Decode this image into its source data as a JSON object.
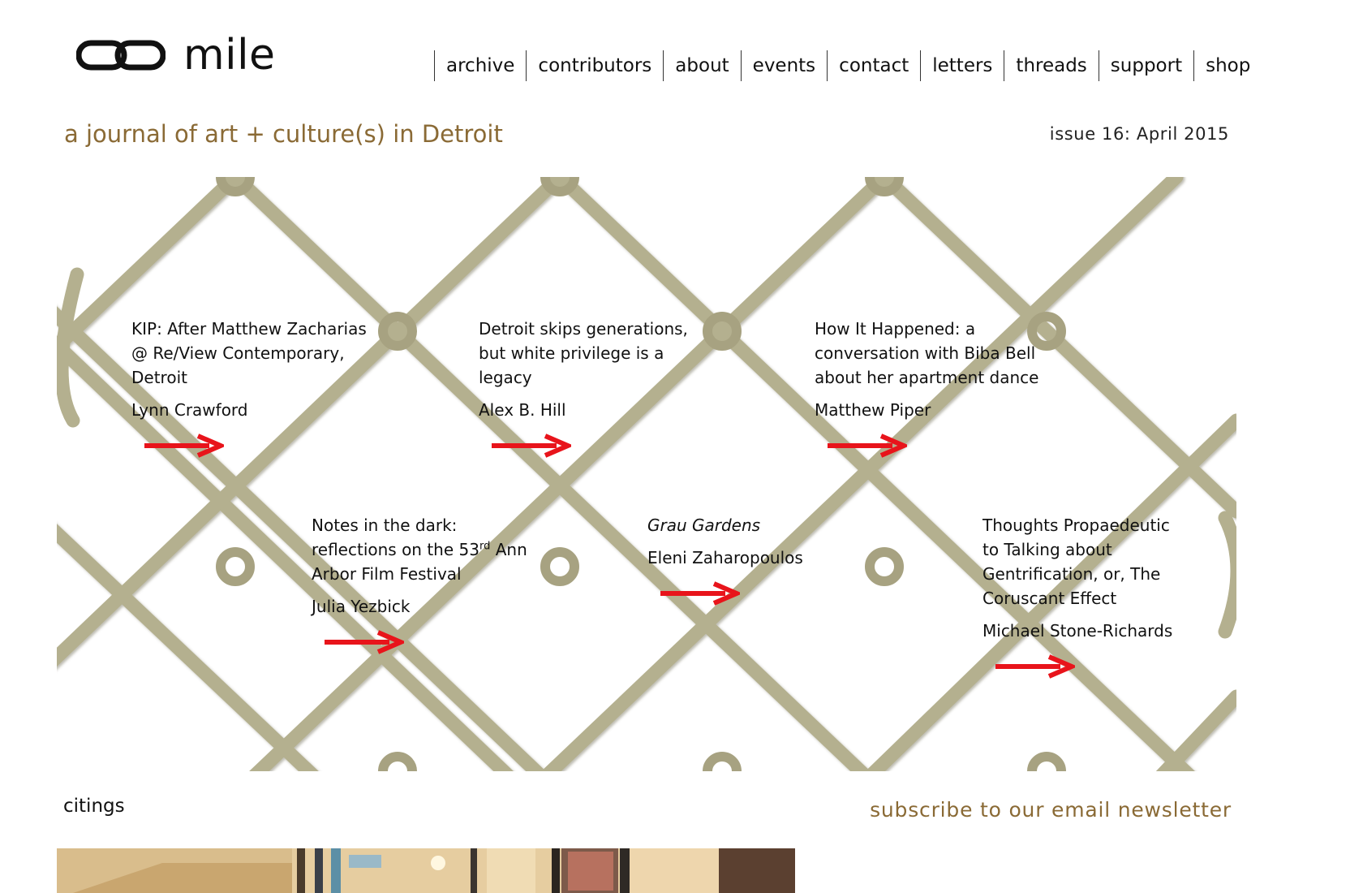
{
  "site": {
    "logo_text": "mile",
    "tagline": "a journal of art + culture(s) in Detroit",
    "issue": "issue 16: April 2015"
  },
  "nav": [
    "archive",
    "contributors",
    "about",
    "events",
    "contact",
    "letters",
    "threads",
    "support",
    "shop"
  ],
  "articles": [
    {
      "title": "KIP: After Matthew Zacharias @ Re/View Contemporary, Detroit",
      "author": "Lynn Crawford"
    },
    {
      "title": "Detroit skips generations, but white privilege is a legacy",
      "author": "Alex B. Hill"
    },
    {
      "title": "How It Happened: a conversation with Biba Bell about her apartment dance",
      "author": "Matthew Piper"
    },
    {
      "title_before": "Notes in the dark: reflections on the 53",
      "title_sup": "rd",
      "title_after": " Ann Arbor Film Festival",
      "author": "Julia Yezbick"
    },
    {
      "title": "Grau Gardens",
      "author": "Eleni Zaharopoulos"
    },
    {
      "title": "Thoughts Propaedeutic to Talking about Gentrification, or, The Coruscant Effect",
      "author": "Michael Stone-Richards"
    }
  ],
  "sections": {
    "citings": "citings",
    "subscribe": "subscribe to our email newsletter"
  },
  "colors": {
    "accent_brown": "#8a6a35",
    "arrow_red": "#e8141b",
    "fence_wire": "#b4b08f"
  },
  "icons": [
    "infinity-logo-icon",
    "red-arrow-icon"
  ]
}
